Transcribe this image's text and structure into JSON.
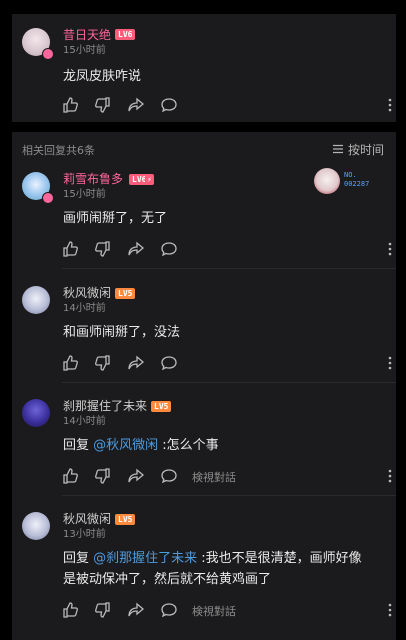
{
  "top_comment": {
    "username": "昔日天绝",
    "level": "LV6",
    "time": "15小时前",
    "text": "龙凤皮肤咋说"
  },
  "replies_header": {
    "count_label": "相关回复共6条",
    "sort_label": "按时间"
  },
  "replies": [
    {
      "username": "莉雪布鲁多",
      "level": "LV6",
      "level_extra": "⚡",
      "time": "15小时前",
      "text": "画师闹掰了，无了",
      "badge": "NO.\n002287"
    },
    {
      "username": "秋风微闲",
      "level": "LV5",
      "time": "14小时前",
      "text": "和画师闹掰了，没法"
    },
    {
      "username": "刹那握住了未来",
      "level": "LV5",
      "time": "14小时前",
      "reply_prefix": "回复",
      "mention": "@秋风微闲",
      "text": " :怎么个事",
      "view_label": "検視對話"
    },
    {
      "username": "秋风微闲",
      "level": "LV5",
      "time": "13小时前",
      "reply_prefix": "回复",
      "mention": "@刹那握住了未来",
      "text": " :我也不是很清楚，画师好像",
      "text_line2": "是被动保冲了，然后就不给黄鸡画了",
      "view_label": "検視對話"
    }
  ],
  "colors": {
    "lv6": "#ff5c7c",
    "lv5": "#ff8a3d",
    "vip_name": "#ff6699",
    "link": "#4e9be0"
  },
  "icons": [
    "like-icon",
    "dislike-icon",
    "share-icon",
    "comment-icon",
    "more-icon",
    "sort-icon"
  ]
}
